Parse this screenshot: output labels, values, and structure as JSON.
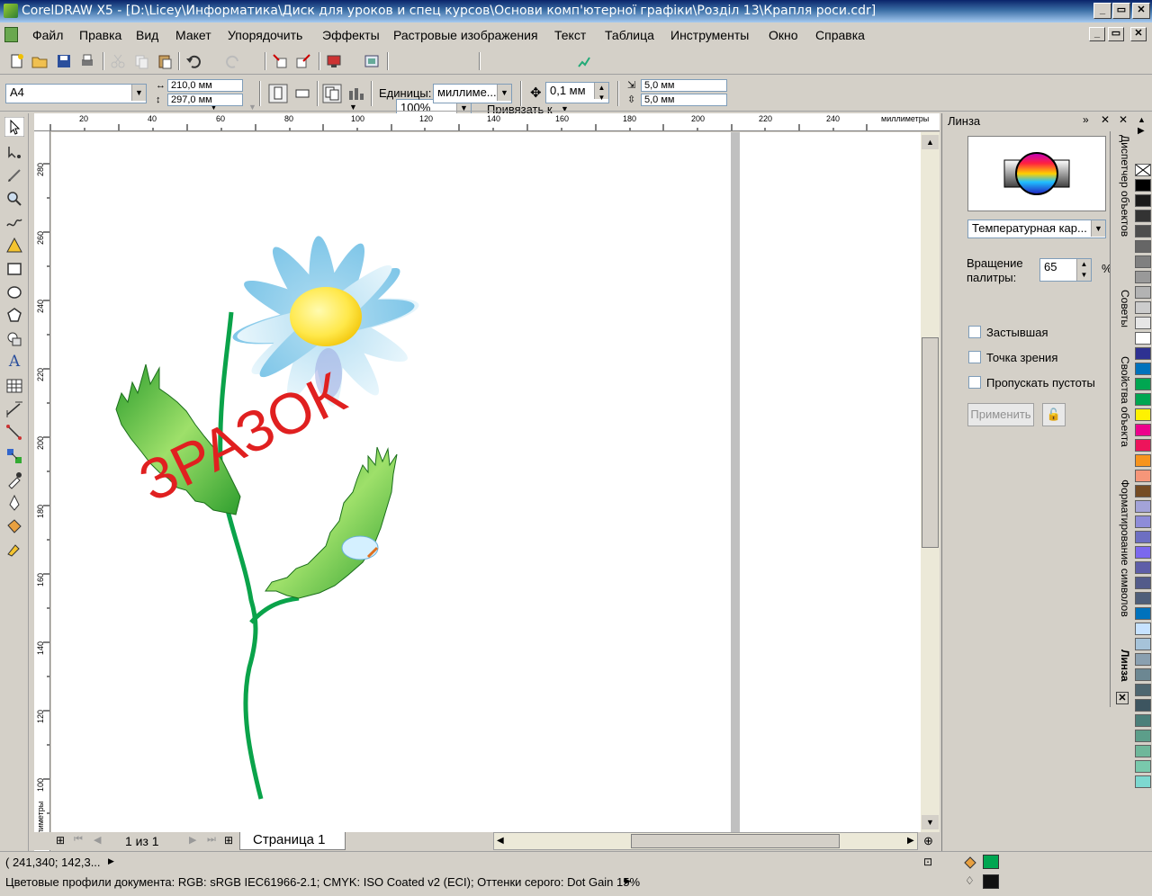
{
  "window": {
    "title": "CorelDRAW X5 - [D:\\Licey\\Информатика\\Диск для уроков и спец курсов\\Основи комп'ютерної графіки\\Розділ 13\\Крапля роси.cdr]",
    "buttons": [
      "_",
      "▭",
      "✕"
    ]
  },
  "menu": [
    "Файл",
    "Правка",
    "Вид",
    "Макет",
    "Упорядочить",
    "Эффекты",
    "Растровые изображения",
    "Текст",
    "Таблица",
    "Инструменты",
    "Окно",
    "Справка"
  ],
  "toolbar": {
    "zoom": "100%",
    "snap_label": "Привязать к"
  },
  "propertybar": {
    "page_size": "A4",
    "width": "210,0 мм",
    "height": "297,0 мм",
    "units_label": "Единицы:",
    "units_value": "миллиме...",
    "nudge": "0,1 мм",
    "dup_x": "5,0 мм",
    "dup_y": "5,0 мм"
  },
  "ruler": {
    "unit_label": "миллиметры",
    "h_ticks": [
      "20",
      "40",
      "60",
      "80",
      "100",
      "120",
      "140",
      "160",
      "180",
      "200",
      "220",
      "240"
    ],
    "v_ticks": [
      "280",
      "260",
      "240",
      "220",
      "200",
      "180",
      "160",
      "140",
      "120",
      "100"
    ],
    "v_unit_label": "миллиметры"
  },
  "canvas": {
    "watermark": "ЗРАЗОК"
  },
  "docker": {
    "title": "Линза",
    "lens_type": "Температурная кар...",
    "rotation_label_1": "Вращение",
    "rotation_label_2": "палитры:",
    "rotation_value": "65",
    "rotation_unit": "%",
    "frozen": "Застывшая",
    "viewpoint": "Точка зрения",
    "skip_blank": "Пропускать пустоты",
    "apply": "Применить",
    "tabs": [
      "Диспетчер объектов",
      "Советы",
      "Свойства объекта",
      "Форматирование символов",
      "Линза"
    ]
  },
  "pagenav": {
    "counter": "1 из 1",
    "page_tab": "Страница 1"
  },
  "status": {
    "coords": "( 241,340; 142,3...",
    "color_profiles": "Цветовые профили документа: RGB: sRGB IEC61966-2.1; CMYK: ISO Coated v2 (ECI); Оттенки серого: Dot Gain 15%"
  },
  "palette_colors": [
    "#ffffff",
    "#000000",
    "#1a1a1a",
    "#333333",
    "#4d4d4d",
    "#666666",
    "#808080",
    "#999999",
    "#b3b3b3",
    "#cccccc",
    "#e6e6e6",
    "#ffffff",
    "#2e3192",
    "#0072bc",
    "#00a651",
    "#00a651",
    "#fff200",
    "#ec008c",
    "#ed145b",
    "#f7941d",
    "#f69679",
    "#754c24",
    "#a3a3d8",
    "#8e8cd8",
    "#6d6fc2",
    "#7b68ee",
    "#5e5ea8",
    "#535b8a",
    "#4f5f7a",
    "#0072bc",
    "#c6e2ff",
    "#a6c3d9",
    "#8aa0b0",
    "#6c8792",
    "#4e6670",
    "#3d5560",
    "#4b7f7a",
    "#5c9e8a",
    "#6eb79a",
    "#79c9ac",
    "#7dd8d0"
  ]
}
